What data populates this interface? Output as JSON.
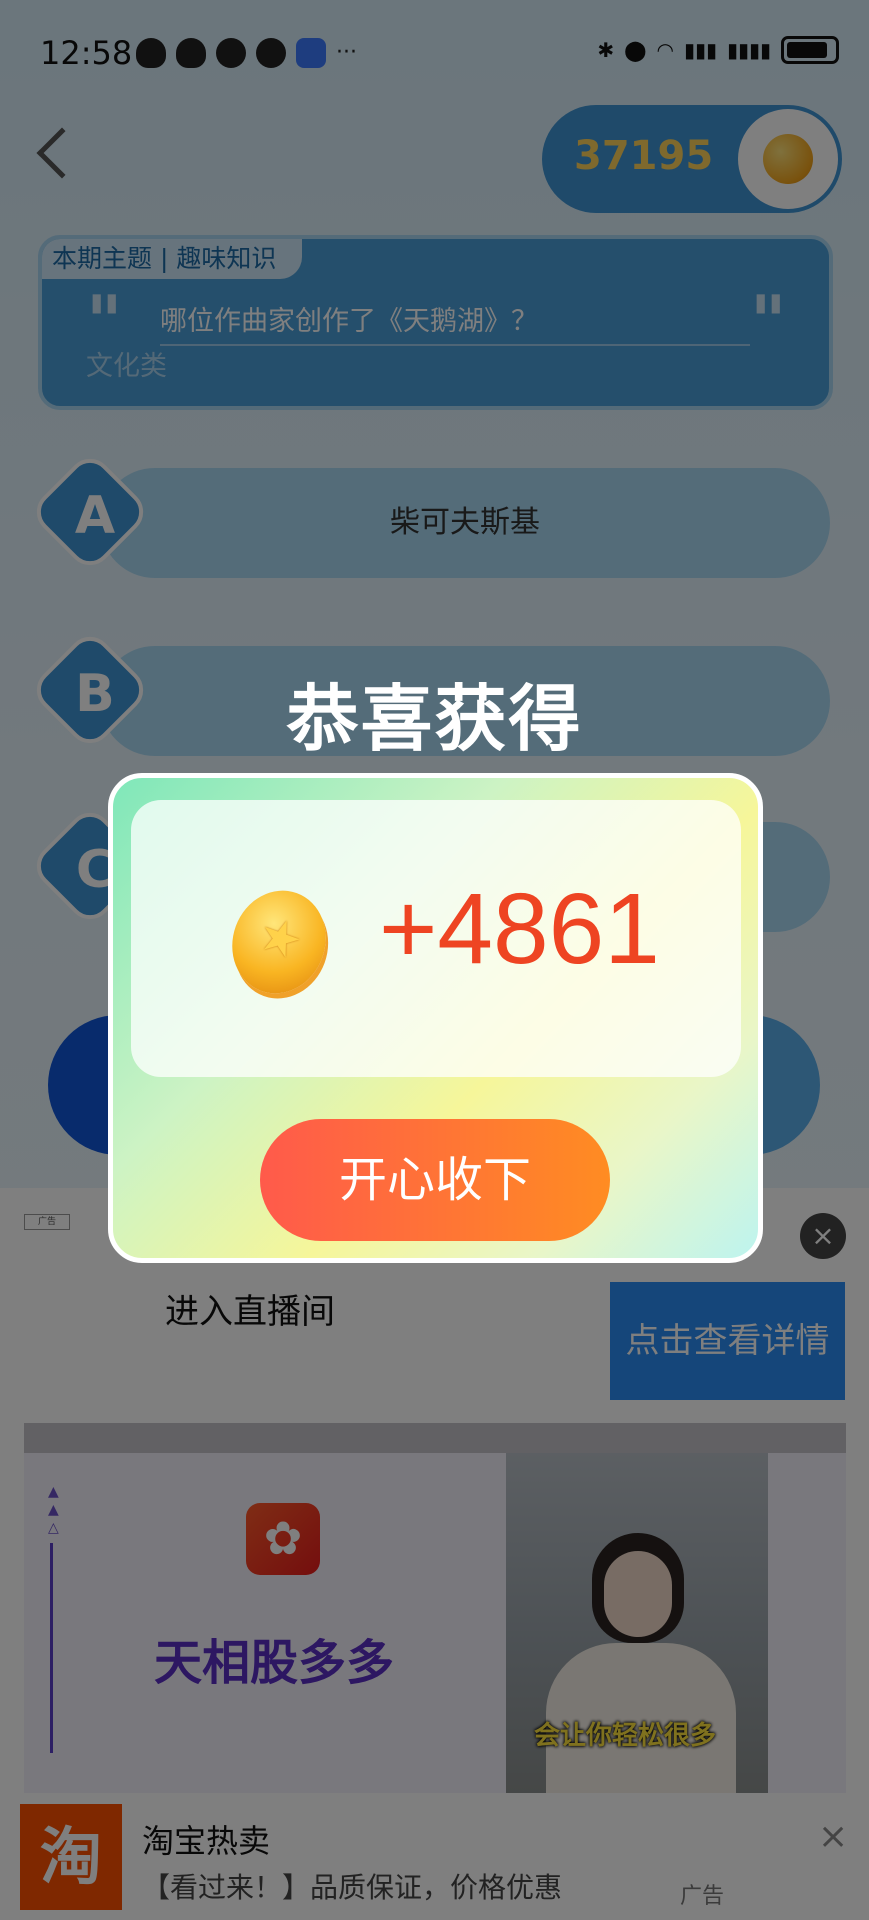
{
  "status_bar": {
    "time": "12:58"
  },
  "header": {
    "score": "37195"
  },
  "question": {
    "topic_tag": "本期主题 | 趣味知识",
    "text": "哪位作曲家创作了《天鹅湖》？",
    "category": "文化类"
  },
  "options": [
    {
      "letter": "A",
      "text": "柴可夫斯基"
    },
    {
      "letter": "B",
      "text": ""
    },
    {
      "letter": "C",
      "text": ""
    }
  ],
  "ad": {
    "tag": "广告",
    "live_text": "进入直播间",
    "detail_button": "点击查看详情",
    "banner_title": "天相股多多",
    "banner_caption": "会让你轻松很多",
    "bottom_title": "淘宝热卖",
    "bottom_subtitle": "【看过来！】品质保证，价格优惠",
    "bottom_ad_tag": "广告",
    "bottom_logo_text": "淘"
  },
  "reward_popup": {
    "title": "恭喜获得",
    "amount": "+4861",
    "accept_button": "开心收下"
  },
  "colors": {
    "primary_blue": "#3f95d4",
    "reward_red": "#ee4422",
    "button_gradient_start": "#ff5a4b",
    "button_gradient_end": "#ff8c22",
    "coin_gold": "#f9b522"
  }
}
